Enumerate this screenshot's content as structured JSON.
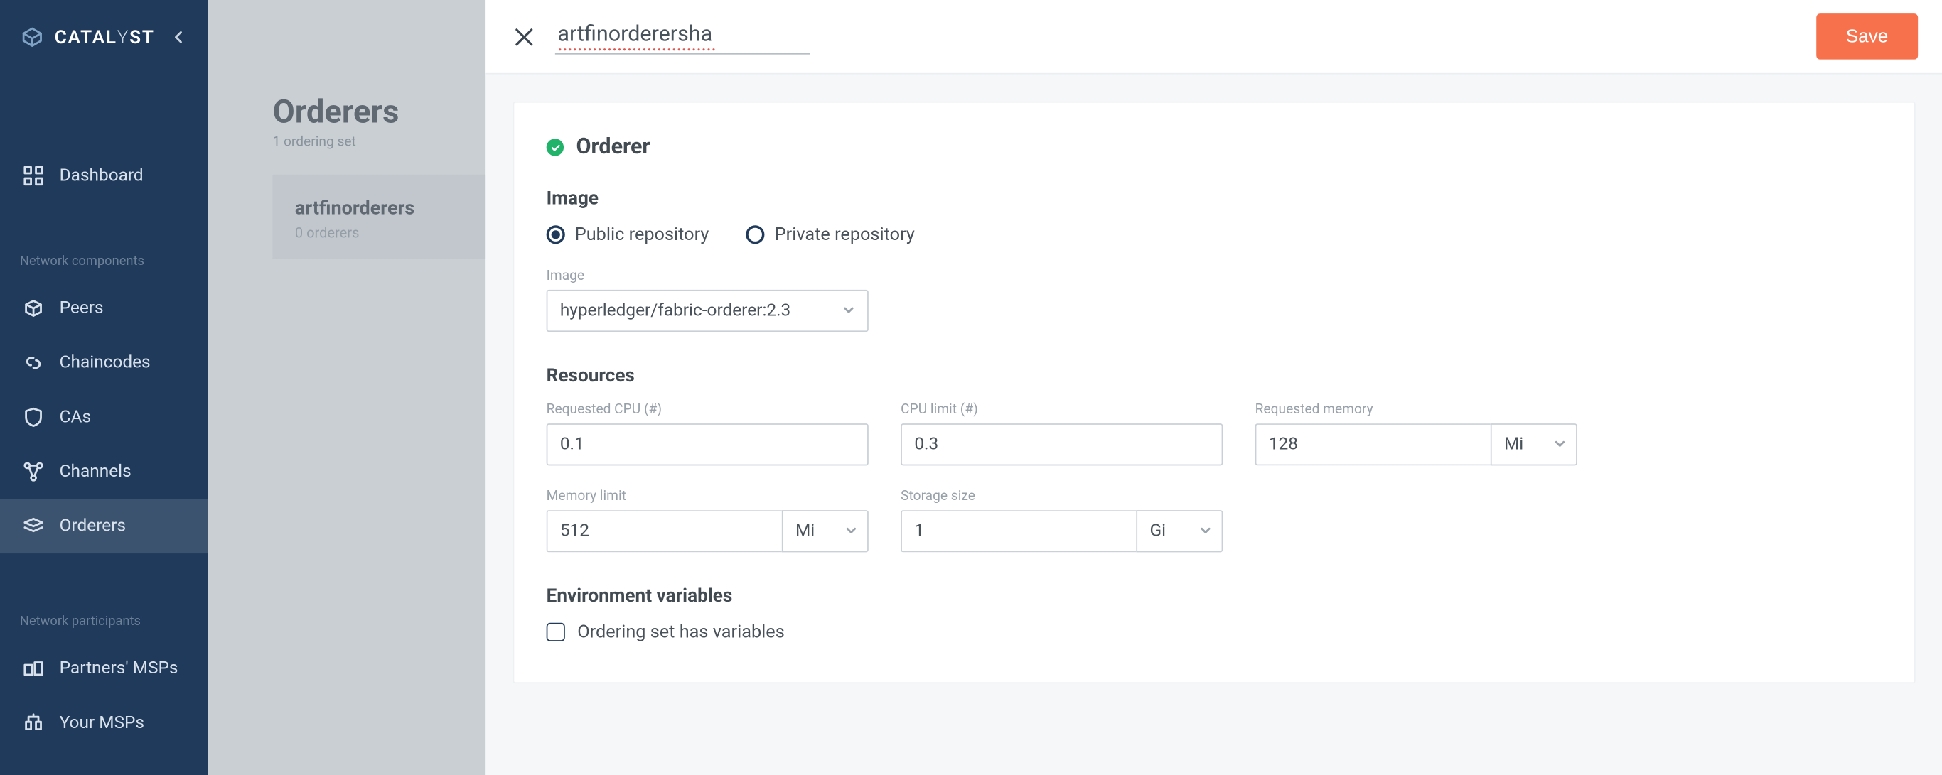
{
  "app": {
    "logo_1": "CATAL",
    "logo_2": "Y",
    "logo_3": "ST"
  },
  "sidebar": {
    "items": [
      {
        "label": "Dashboard"
      }
    ],
    "section1": "Network components",
    "components": [
      {
        "label": "Peers"
      },
      {
        "label": "Chaincodes"
      },
      {
        "label": "CAs"
      },
      {
        "label": "Channels"
      },
      {
        "label": "Orderers"
      }
    ],
    "section2": "Network participants",
    "participants": [
      {
        "label": "Partners' MSPs"
      },
      {
        "label": "Your MSPs"
      }
    ]
  },
  "list": {
    "title": "Orderers",
    "subtitle": "1 ordering set",
    "cards": [
      {
        "name": "artfinorderers",
        "count": "0 orderers"
      }
    ]
  },
  "panel": {
    "title_value": "artfinorderersha",
    "save_label": "Save",
    "card": {
      "title": "Orderer"
    },
    "image": {
      "heading": "Image",
      "public_label": "Public repository",
      "private_label": "Private repository",
      "repo_kind": "public",
      "image_field_label": "Image",
      "image_value": "hyperledger/fabric-orderer:2.3"
    },
    "resources": {
      "heading": "Resources",
      "req_cpu_label": "Requested CPU (#)",
      "req_cpu_value": "0.1",
      "cpu_limit_label": "CPU limit (#)",
      "cpu_limit_value": "0.3",
      "req_mem_label": "Requested memory",
      "req_mem_value": "128",
      "req_mem_unit": "Mi",
      "mem_limit_label": "Memory limit",
      "mem_limit_value": "512",
      "mem_limit_unit": "Mi",
      "storage_label": "Storage size",
      "storage_value": "1",
      "storage_unit": "Gi"
    },
    "env": {
      "heading": "Environment variables",
      "checkbox_label": "Ordering set has variables",
      "has_variables": false
    }
  }
}
